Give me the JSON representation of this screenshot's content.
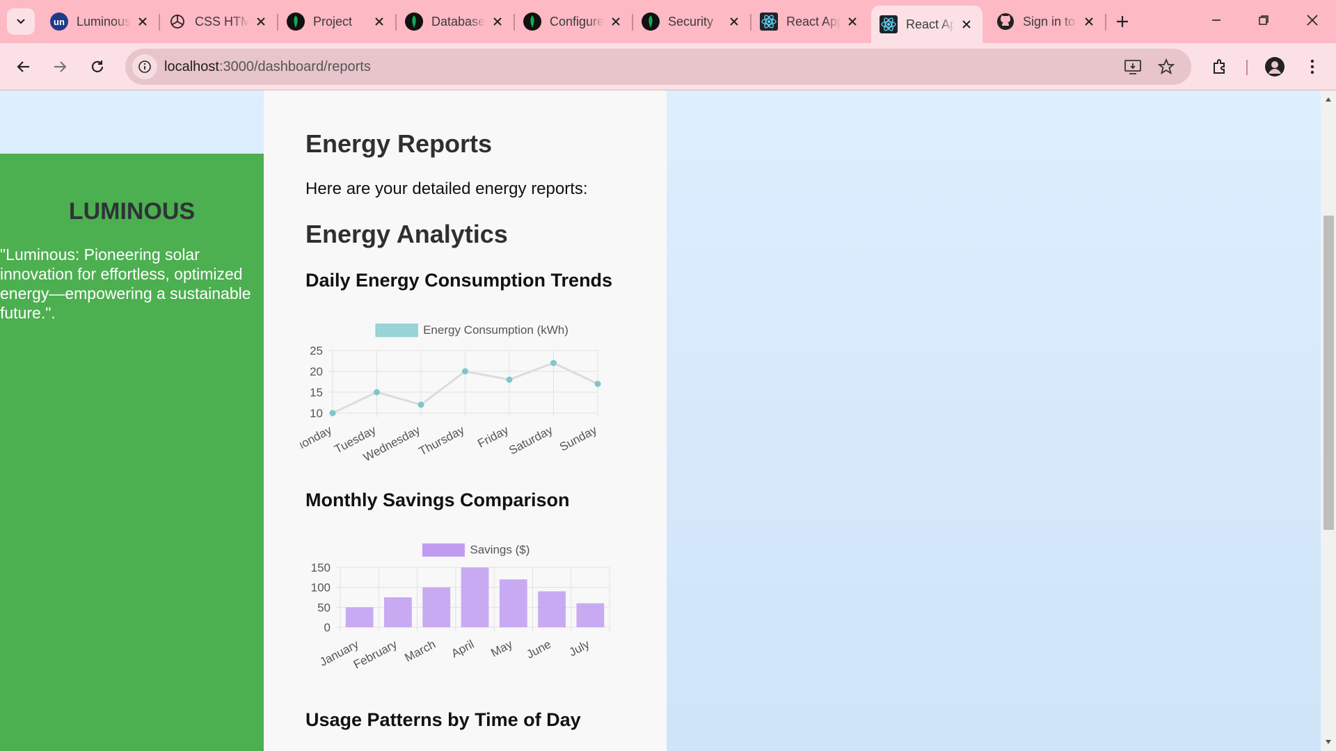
{
  "browser": {
    "tabs": [
      {
        "title": "Luminous",
        "favicon": "un-logo-icon"
      },
      {
        "title": "CSS HTML",
        "favicon": "openai-icon"
      },
      {
        "title": "Project",
        "favicon": "mongodb-leaf-icon"
      },
      {
        "title": "Database",
        "favicon": "mongodb-leaf-icon"
      },
      {
        "title": "Configure",
        "favicon": "mongodb-leaf-icon"
      },
      {
        "title": "Security",
        "favicon": "mongodb-leaf-icon"
      },
      {
        "title": "React App",
        "favicon": "react-icon"
      },
      {
        "title": "React App",
        "favicon": "react-icon",
        "active": true
      },
      {
        "title": "Sign in to GitHub",
        "favicon": "github-icon"
      }
    ],
    "url": {
      "host": "localhost",
      "path": ":3000/dashboard/reports"
    },
    "colors": {
      "tabbar": "#fdb9c4",
      "toolbar": "#fbe1e6"
    }
  },
  "sidebar": {
    "brand": "LUMINOUS",
    "tagline": "\"Luminous: Pioneering solar innovation for effortless, optimized energy—empowering a sustainable future.\"."
  },
  "main": {
    "title": "Energy Reports",
    "intro": "Here are your detailed energy reports:",
    "analytics_title": "Energy Analytics",
    "sections": {
      "daily": "Daily Energy Consumption Trends",
      "monthly": "Monthly Savings Comparison",
      "usage": "Usage Patterns by Time of Day"
    }
  },
  "chart_data": [
    {
      "type": "line",
      "categories": [
        "Monday",
        "Tuesday",
        "Wednesday",
        "Thursday",
        "Friday",
        "Saturday",
        "Sunday"
      ],
      "series": [
        {
          "name": "Energy Consumption (kWh)",
          "values": [
            10,
            15,
            12,
            20,
            18,
            22,
            17
          ],
          "color": "#7cc8cc"
        }
      ],
      "ylim": [
        10,
        25
      ],
      "yticks": [
        10,
        15,
        20,
        25
      ],
      "grid": true,
      "legend": "top"
    },
    {
      "type": "bar",
      "categories": [
        "January",
        "February",
        "March",
        "April",
        "May",
        "June",
        "July"
      ],
      "series": [
        {
          "name": "Savings ($)",
          "values": [
            50,
            75,
            100,
            150,
            120,
            90,
            60
          ],
          "color": "#bf9cf2"
        }
      ],
      "ylim": [
        0,
        150
      ],
      "yticks": [
        0,
        50,
        100,
        150
      ],
      "grid": true,
      "legend": "top"
    }
  ]
}
